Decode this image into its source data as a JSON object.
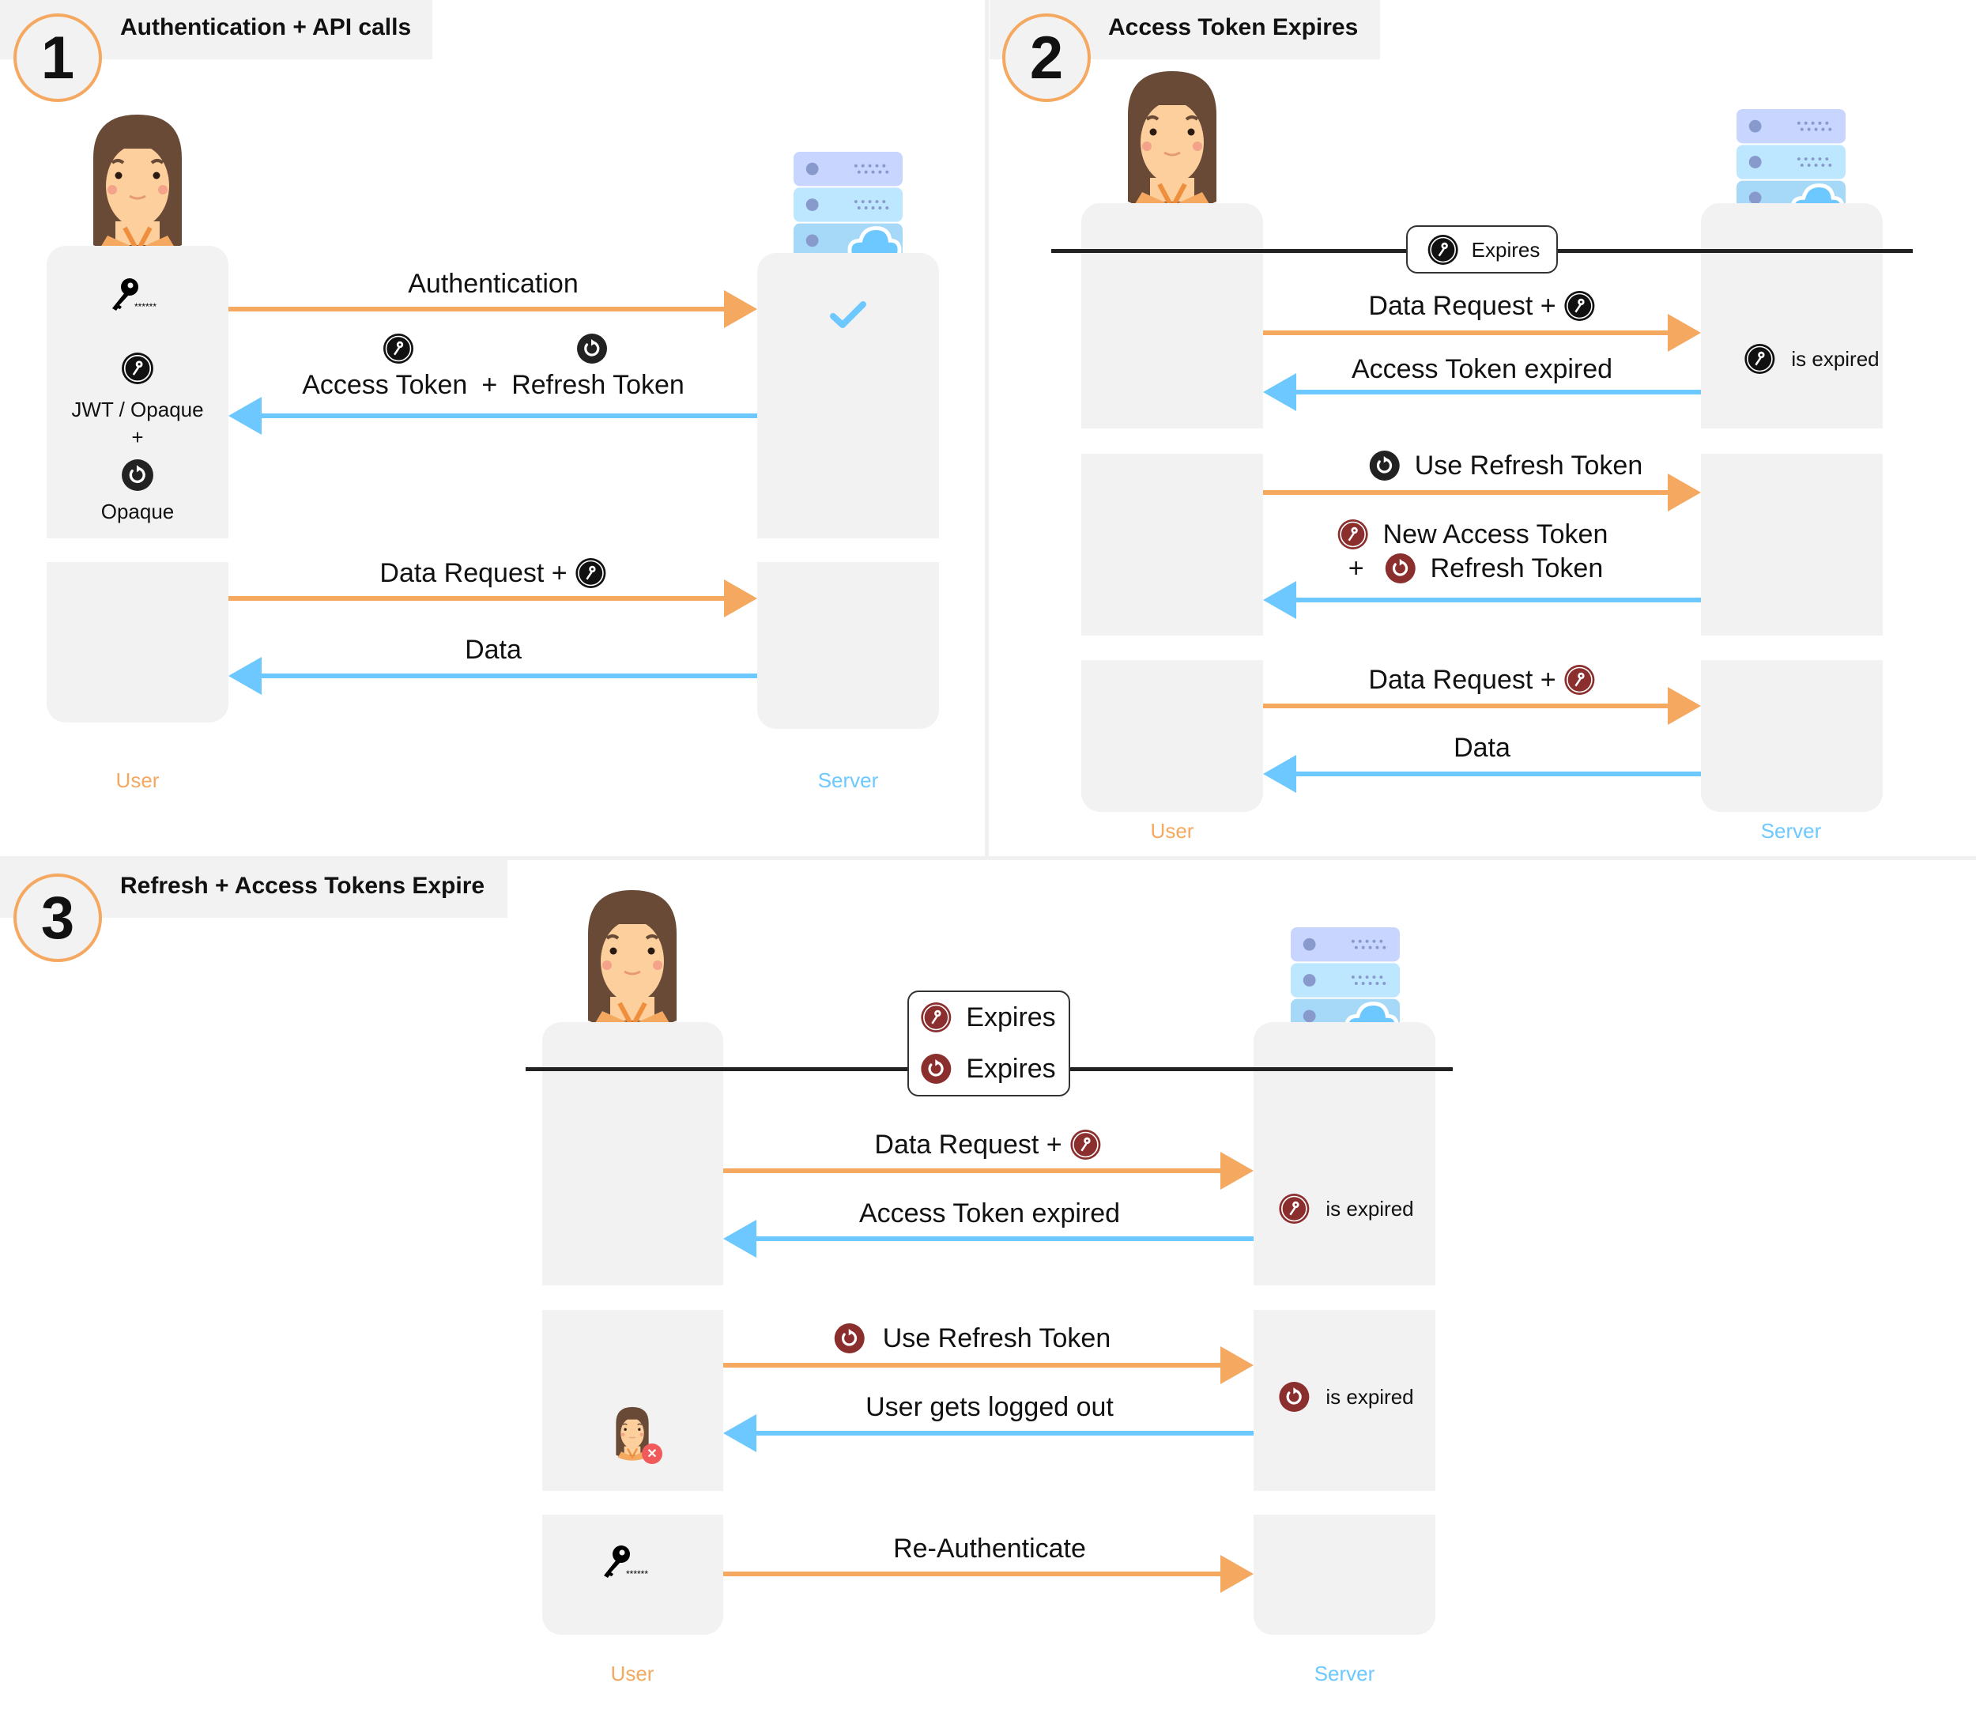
{
  "colors": {
    "request_arrow": "#f4a860",
    "response_arrow": "#6cc8ff",
    "access_token_valid": "#111111",
    "token_expired": "#8b2e2e",
    "user_label": "#f4a860",
    "server_label": "#6cc8ff",
    "panel_bg": "#f2f2f2"
  },
  "panels": [
    {
      "number": "1",
      "title": "Authentication + API calls",
      "user_label": "User",
      "server_label": "Server",
      "user_notes": {
        "access_token_type": "JWT / Opaque",
        "plus": "+",
        "refresh_token_type": "Opaque",
        "password_mask": "******"
      },
      "messages": [
        {
          "direction": "request",
          "label": "Authentication"
        },
        {
          "direction": "response",
          "label_parts": [
            "Access Token",
            "+",
            "Refresh Token"
          ],
          "tokens": [
            "access-token-icon",
            "refresh-token-icon"
          ]
        },
        {
          "direction": "request",
          "label": "Data Request +",
          "token": "access-token-icon"
        },
        {
          "direction": "response",
          "label": "Data"
        }
      ],
      "server_status": "checkmark-icon"
    },
    {
      "number": "2",
      "title": "Access Token Expires",
      "user_label": "User",
      "server_label": "Server",
      "event": {
        "label": "Expires",
        "token": "access-token-icon"
      },
      "server_notes": [
        {
          "token": "access-token-icon",
          "label": "is expired"
        }
      ],
      "messages": [
        {
          "direction": "request",
          "label": "Data Request +",
          "token": "access-token-icon"
        },
        {
          "direction": "response",
          "label": "Access Token expired"
        },
        {
          "direction": "request",
          "label": "Use Refresh Token",
          "token": "refresh-token-icon"
        },
        {
          "direction": "response",
          "label_lines": [
            "New Access Token",
            "Refresh Token"
          ],
          "plus": "+",
          "tokens": [
            "new-access-token-icon",
            "new-refresh-token-icon"
          ]
        },
        {
          "direction": "request",
          "label": "Data Request +",
          "token": "new-access-token-icon"
        },
        {
          "direction": "response",
          "label": "Data"
        }
      ]
    },
    {
      "number": "3",
      "title": "Refresh + Access Tokens Expire",
      "user_label": "User",
      "server_label": "Server",
      "events": [
        {
          "label": "Expires",
          "token": "access-token-icon"
        },
        {
          "label": "Expires",
          "token": "refresh-token-icon"
        }
      ],
      "server_notes": [
        {
          "token": "access-token-icon",
          "label": "is expired"
        },
        {
          "token": "refresh-token-icon",
          "label": "is expired"
        }
      ],
      "messages": [
        {
          "direction": "request",
          "label": "Data Request +",
          "token": "access-token-icon"
        },
        {
          "direction": "response",
          "label": "Access Token expired"
        },
        {
          "direction": "request",
          "label": "Use Refresh Token",
          "token": "refresh-token-icon"
        },
        {
          "direction": "response",
          "label": "User gets logged out"
        },
        {
          "direction": "request",
          "label": "Re-Authenticate"
        }
      ],
      "password_mask": "******"
    }
  ]
}
